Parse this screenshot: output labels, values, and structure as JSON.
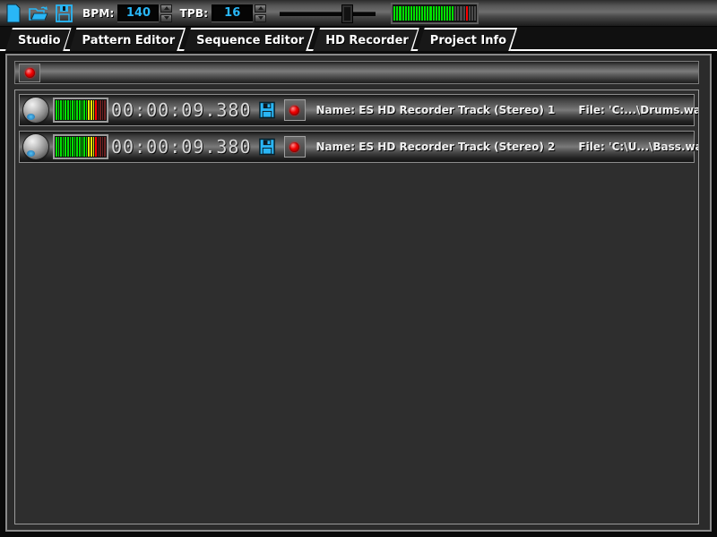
{
  "toolbar": {
    "new_icon": "new-document-icon",
    "open_icon": "open-folder-icon",
    "save_icon": "save-floppy-icon",
    "bpm_label": "BPM:",
    "bpm_value": "140",
    "tpb_label": "TPB:",
    "tpb_value": "16",
    "slider_name": "master-tempo-slider",
    "slider_position_pct": 68,
    "master_meter": {
      "name": "master-vu-meter",
      "total_segments": 30,
      "lit_green": 22,
      "lit_red_index": 26
    },
    "colors": {
      "field_text": "#29b6f6",
      "icon": "#29b6f6",
      "meter_green": "#00e000",
      "meter_yellow": "#e8e800",
      "meter_red": "#ff0000",
      "meter_off": "#4a4a4a",
      "meter_off_red": "#6b2020"
    }
  },
  "tabs": [
    {
      "label": "Studio",
      "active": false
    },
    {
      "label": "Pattern Editor",
      "active": false
    },
    {
      "label": "Sequence Editor",
      "active": false
    },
    {
      "label": "HD Recorder",
      "active": true
    },
    {
      "label": "Project Info",
      "active": false
    }
  ],
  "panel": {
    "record_strip": {
      "record_all_button": "record-all-button",
      "led_color": "#f00000"
    },
    "tracks": [
      {
        "knob": "volume-knob",
        "meter": {
          "total_segments": 22,
          "green": 14,
          "yellow": 3,
          "red": 1,
          "off": 4
        },
        "time": "00:00:09.380",
        "save_icon": "save-floppy-icon",
        "record_button": "track-record-button",
        "name": "Name: ES HD Recorder Track (Stereo) 1",
        "file": "File: 'C:...\\Drums.wav'"
      },
      {
        "knob": "volume-knob",
        "meter": {
          "total_segments": 22,
          "green": 14,
          "yellow": 3,
          "red": 1,
          "off": 4
        },
        "time": "00:00:09.380",
        "save_icon": "save-floppy-icon",
        "record_button": "track-record-button",
        "name": "Name: ES HD Recorder Track (Stereo) 2",
        "file": "File: 'C:\\U...\\Bass.wav'"
      }
    ]
  }
}
